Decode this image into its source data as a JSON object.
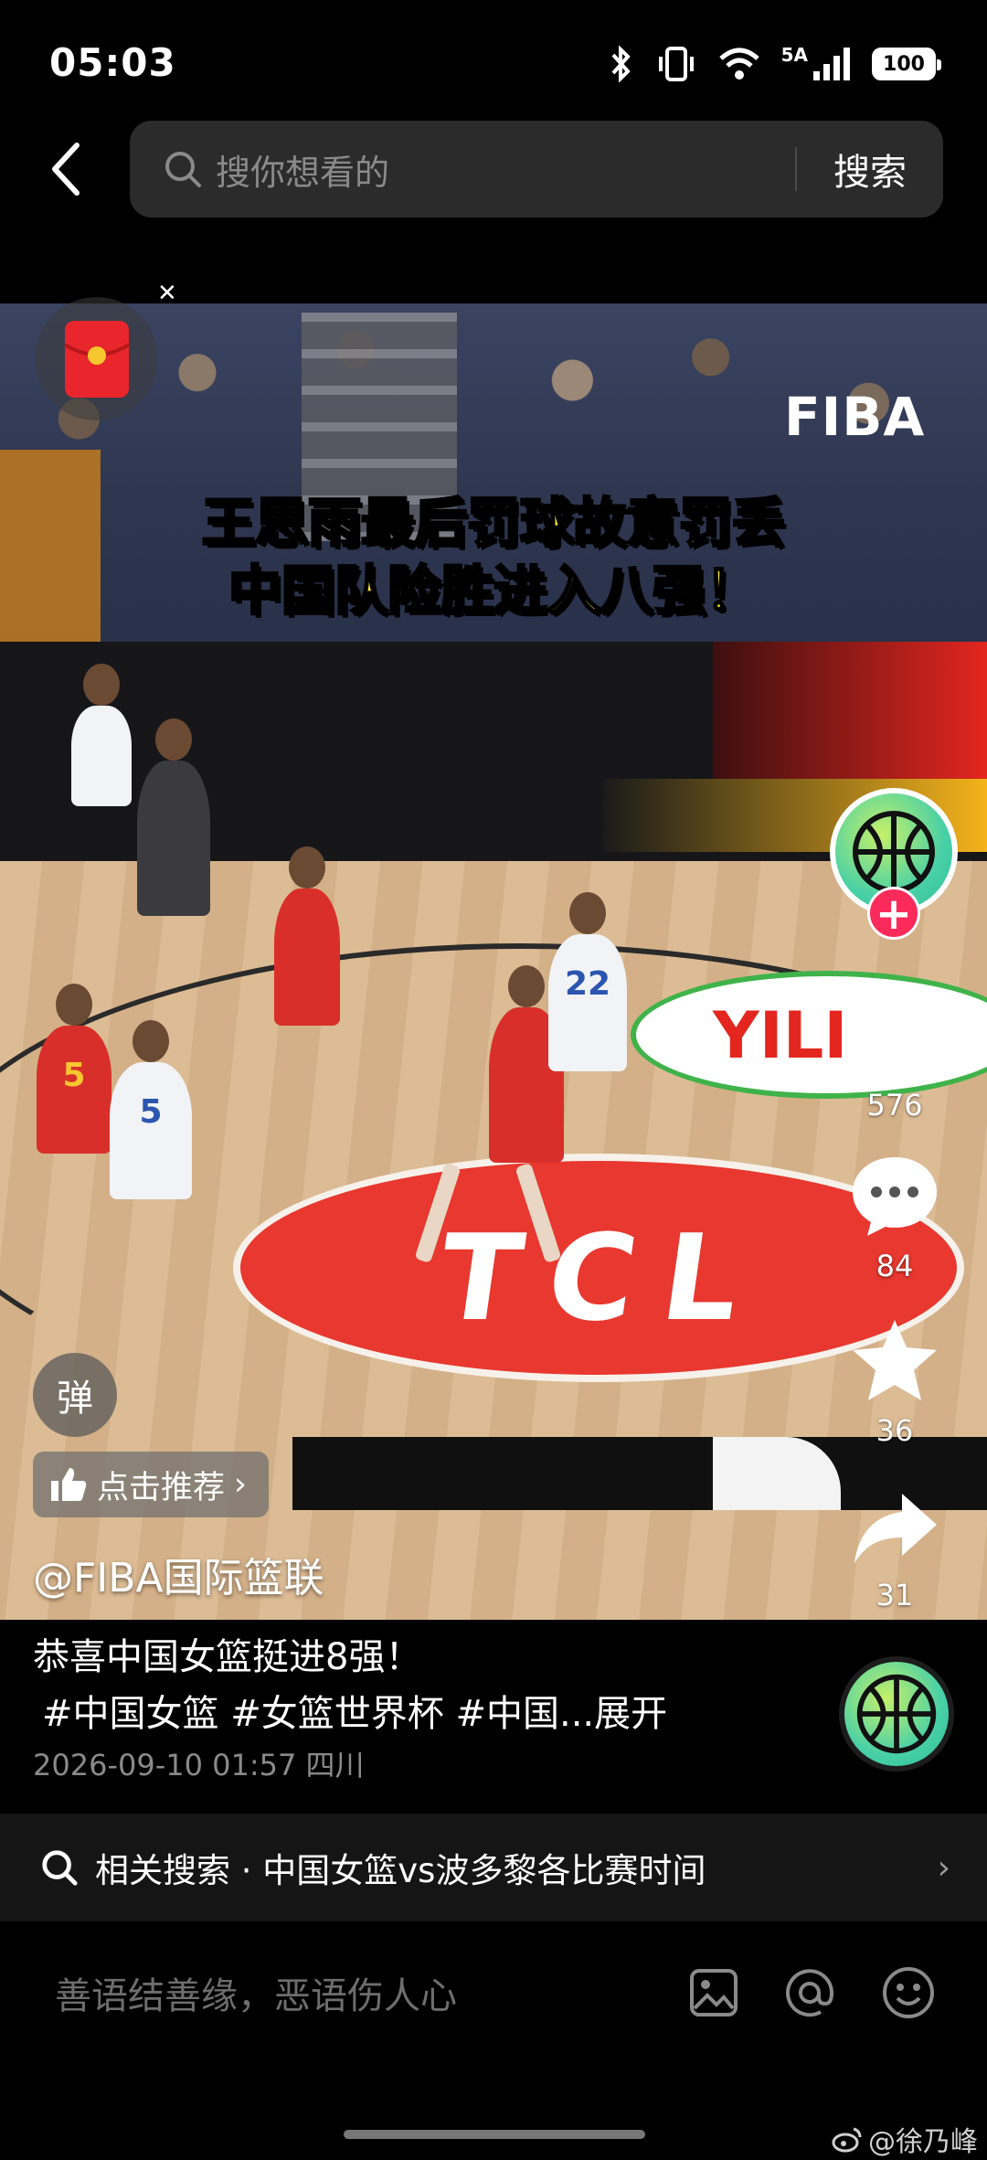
{
  "status_bar": {
    "time": "05:03",
    "network": "5A",
    "battery": "100"
  },
  "search": {
    "placeholder": "搜你想看的",
    "submit_label": "搜索"
  },
  "video": {
    "watermark_logo": "FIBA",
    "headline_line1": "王思雨最后罚球故意罚丢",
    "headline_line2": "中国队险胜进入八强！",
    "court_logo": "TCL",
    "board_logo": "YILI",
    "jersey_numbers": [
      "5",
      "5",
      "5",
      "22"
    ],
    "danmaku_label": "弹",
    "recommend_label": "点击推荐",
    "author": "@FIBA国际篮联"
  },
  "actions": {
    "likes": "576",
    "comments": "84",
    "favorites": "36",
    "shares": "31"
  },
  "description": {
    "title": "恭喜中国女篮挺进8强！",
    "tags": "#中国女篮 #女篮世界杯 #中国...",
    "expand_label": "展开",
    "meta": "2026-09-10 01:57 四川"
  },
  "related_search": {
    "text": "相关搜索 · 中国女篮vs波多黎各比赛时间"
  },
  "comment_bar": {
    "placeholder": "善语结善缘，恶语伤人心"
  },
  "watermark": {
    "text": "@徐乃峰"
  },
  "colors": {
    "accent_pink": "#fa2b5b",
    "headline_yellow": "#fde933",
    "court_red": "#e8382f"
  },
  "icons": [
    "back-arrow-icon",
    "search-icon",
    "bluetooth-icon",
    "vibrate-icon",
    "wifi-icon",
    "signal-icon",
    "battery-icon",
    "red-packet-icon",
    "basketball-avatar-icon",
    "heart-icon",
    "comment-icon",
    "star-icon",
    "share-icon",
    "thumbs-up-icon",
    "chevron-right-icon",
    "image-icon",
    "at-icon",
    "emoji-icon",
    "weibo-icon"
  ]
}
